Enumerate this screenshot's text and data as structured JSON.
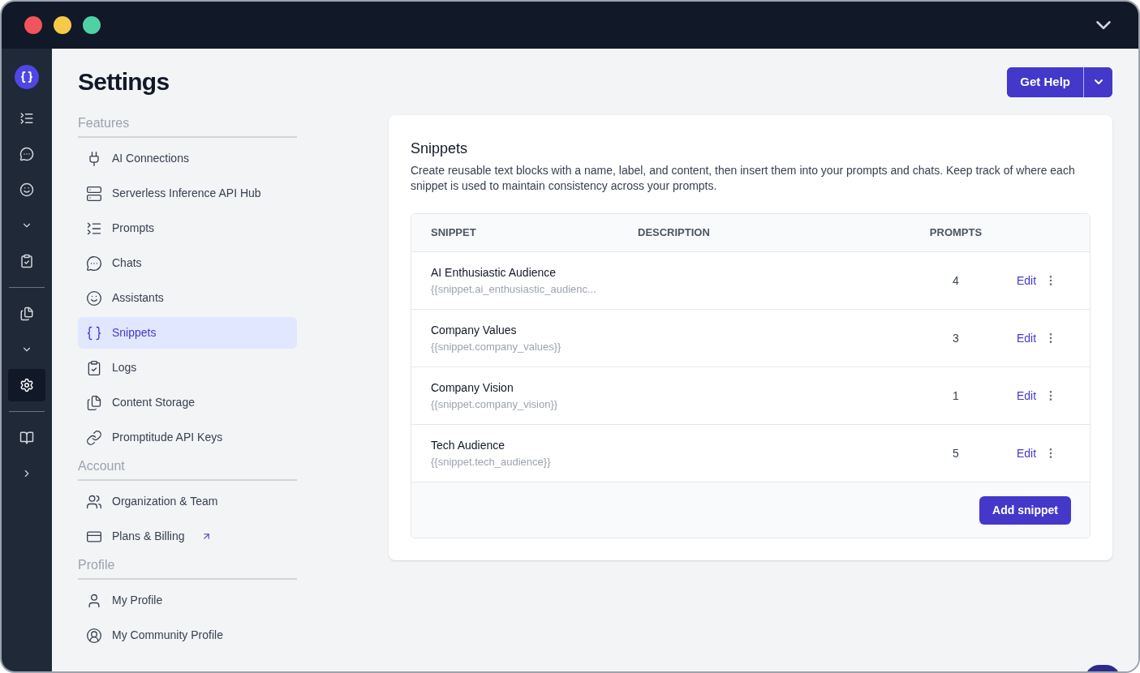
{
  "rail": {
    "items": [
      {
        "selected": false
      },
      {
        "selected": false
      },
      {
        "selected": false
      },
      {
        "selected": false
      },
      {
        "selected": false
      },
      {
        "selected": false
      },
      {
        "selected": false
      },
      {
        "selected": true
      },
      {
        "selected": false
      },
      {
        "selected": false
      }
    ]
  },
  "page": {
    "title": "Settings",
    "help_button": "Get Help"
  },
  "nav": {
    "sections": [
      {
        "heading": "Features",
        "items": [
          {
            "label": "AI Connections",
            "selected": false,
            "external": false
          },
          {
            "label": "Serverless Inference API Hub",
            "selected": false,
            "external": false
          },
          {
            "label": "Prompts",
            "selected": false,
            "external": false
          },
          {
            "label": "Chats",
            "selected": false,
            "external": false
          },
          {
            "label": "Assistants",
            "selected": false,
            "external": false
          },
          {
            "label": "Snippets",
            "selected": true,
            "external": false
          },
          {
            "label": "Logs",
            "selected": false,
            "external": false
          },
          {
            "label": "Content Storage",
            "selected": false,
            "external": false
          },
          {
            "label": "Promptitude API Keys",
            "selected": false,
            "external": false
          }
        ]
      },
      {
        "heading": "Account",
        "items": [
          {
            "label": "Organization & Team",
            "selected": false,
            "external": false
          },
          {
            "label": "Plans & Billing",
            "selected": false,
            "external": true
          }
        ]
      },
      {
        "heading": "Profile",
        "items": [
          {
            "label": "My Profile",
            "selected": false,
            "external": false
          },
          {
            "label": "My Community Profile",
            "selected": false,
            "external": false
          }
        ]
      }
    ]
  },
  "card": {
    "title": "Snippets",
    "description": "Create reusable text blocks with a name, label, and content, then insert them into your prompts and chats. Keep track of where each snippet is used to maintain consistency across your prompts.",
    "table": {
      "columns": [
        "SNIPPET",
        "DESCRIPTION",
        "PROMPTS"
      ],
      "rows": [
        {
          "name": "AI Enthusiastic Audience",
          "key": "{{snippet.ai_enthusiastic_audienc...",
          "prompts": "4",
          "action": "Edit"
        },
        {
          "name": "Company Values",
          "key": "{{snippet.company_values}}",
          "prompts": "3",
          "action": "Edit"
        },
        {
          "name": "Company Vision",
          "key": "{{snippet.company_vision}}",
          "prompts": "1",
          "action": "Edit"
        },
        {
          "name": "Tech Audience",
          "key": "{{snippet.tech_audience}}",
          "prompts": "5",
          "action": "Edit"
        }
      ]
    },
    "add_button": "Add snippet"
  }
}
